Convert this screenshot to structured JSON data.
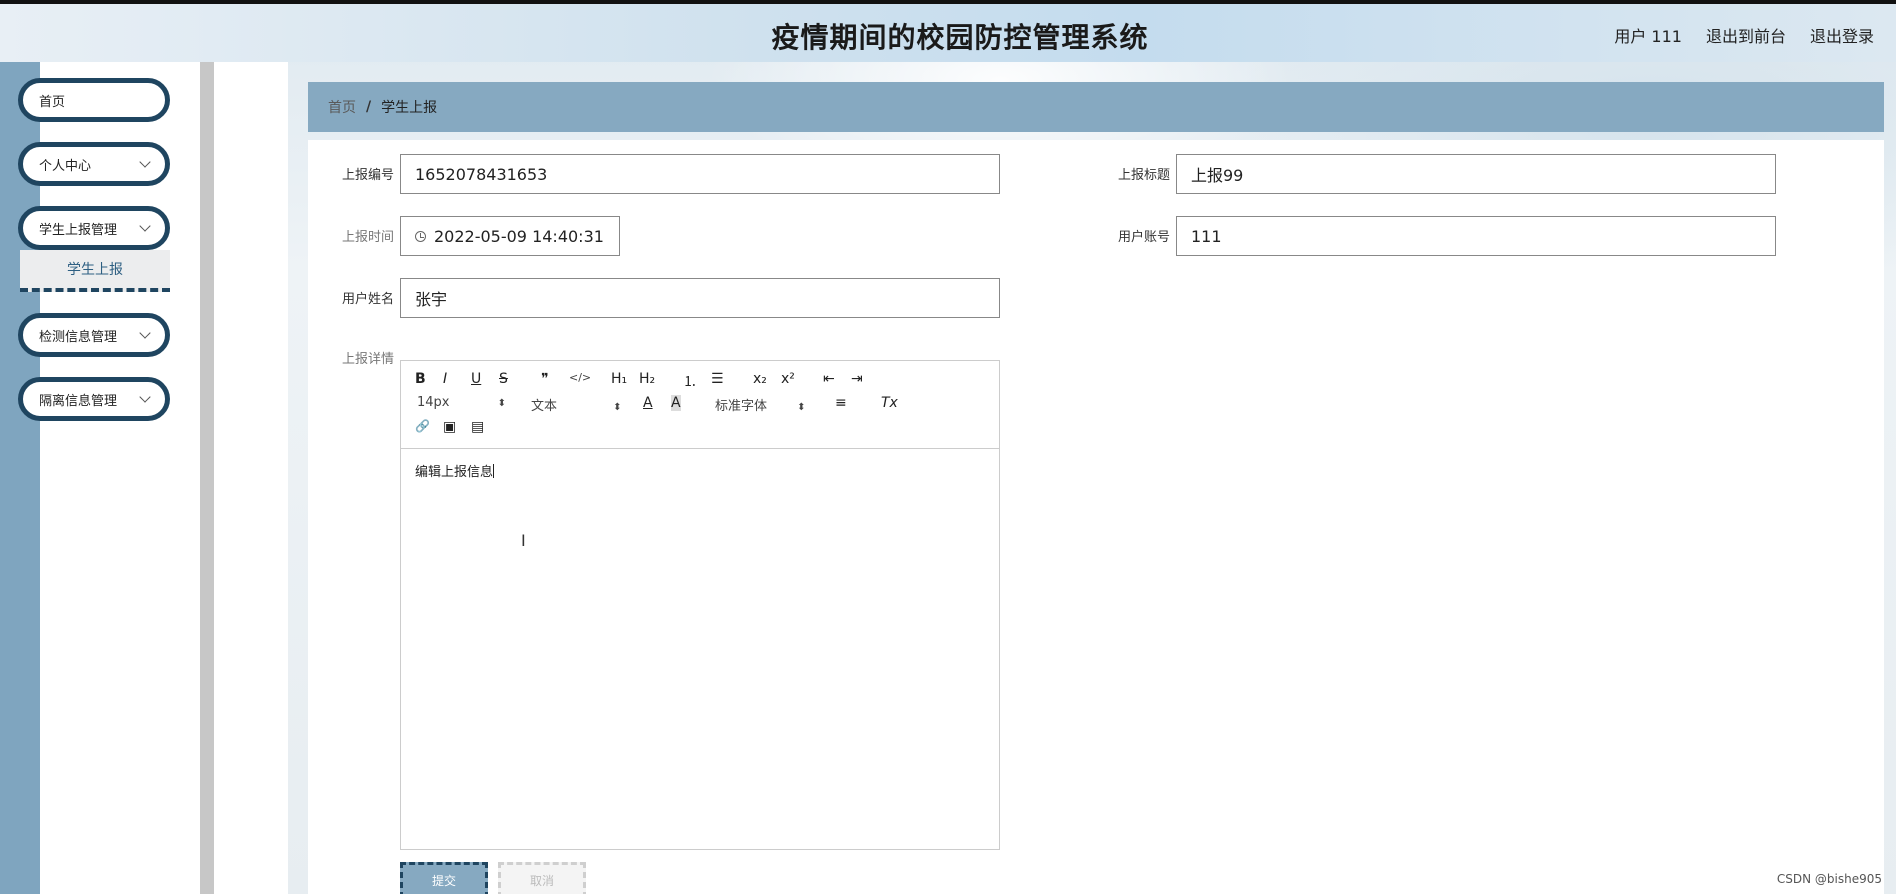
{
  "app": {
    "title": "疫情期间的校园防控管理系统",
    "user_label": "用户 111",
    "to_front_label": "退出到前台",
    "logout_label": "退出登录"
  },
  "sidebar": {
    "items": [
      {
        "label": "首页",
        "has_chevron": false
      },
      {
        "label": "个人中心",
        "has_chevron": true
      },
      {
        "label": "学生上报管理",
        "has_chevron": true
      },
      {
        "label": "检测信息管理",
        "has_chevron": true
      },
      {
        "label": "隔离信息管理",
        "has_chevron": true
      }
    ],
    "submenu": {
      "label": "学生上报"
    }
  },
  "breadcrumb": {
    "home": "首页",
    "sep": "/",
    "current": "学生上报"
  },
  "form": {
    "report_no": {
      "label": "上报编号",
      "value": "1652078431653"
    },
    "report_title": {
      "label": "上报标题",
      "value": "上报99"
    },
    "report_time": {
      "label": "上报时间",
      "value": "2022-05-09 14:40:31"
    },
    "account": {
      "label": "用户账号",
      "value": "111"
    },
    "user_name": {
      "label": "用户姓名",
      "value": "张宇"
    },
    "details": {
      "label": "上报详情",
      "content": "编辑上报信息"
    }
  },
  "editor": {
    "bold": "B",
    "italic": "I",
    "underline": "U",
    "strike": "S",
    "quote": "❞",
    "code": "</>",
    "h1": "H₁",
    "h2": "H₂",
    "ol": "⒈",
    "ul": "☰",
    "sub": "x₂",
    "sup": "x²",
    "indent_left": "⇤",
    "indent_right": "⇥",
    "size": "14px",
    "text_type": "文本",
    "font": "标准字体",
    "font_color": "A",
    "bg_color": "A",
    "align": "≡",
    "clear": "Tx",
    "link": "🔗",
    "image": "▣",
    "video": "▤"
  },
  "buttons": {
    "submit": "提交",
    "cancel": "取消"
  },
  "watermark": "CSDN @bishe905",
  "colors": {
    "accent": "#86a9c1",
    "dark": "#1f4560"
  }
}
